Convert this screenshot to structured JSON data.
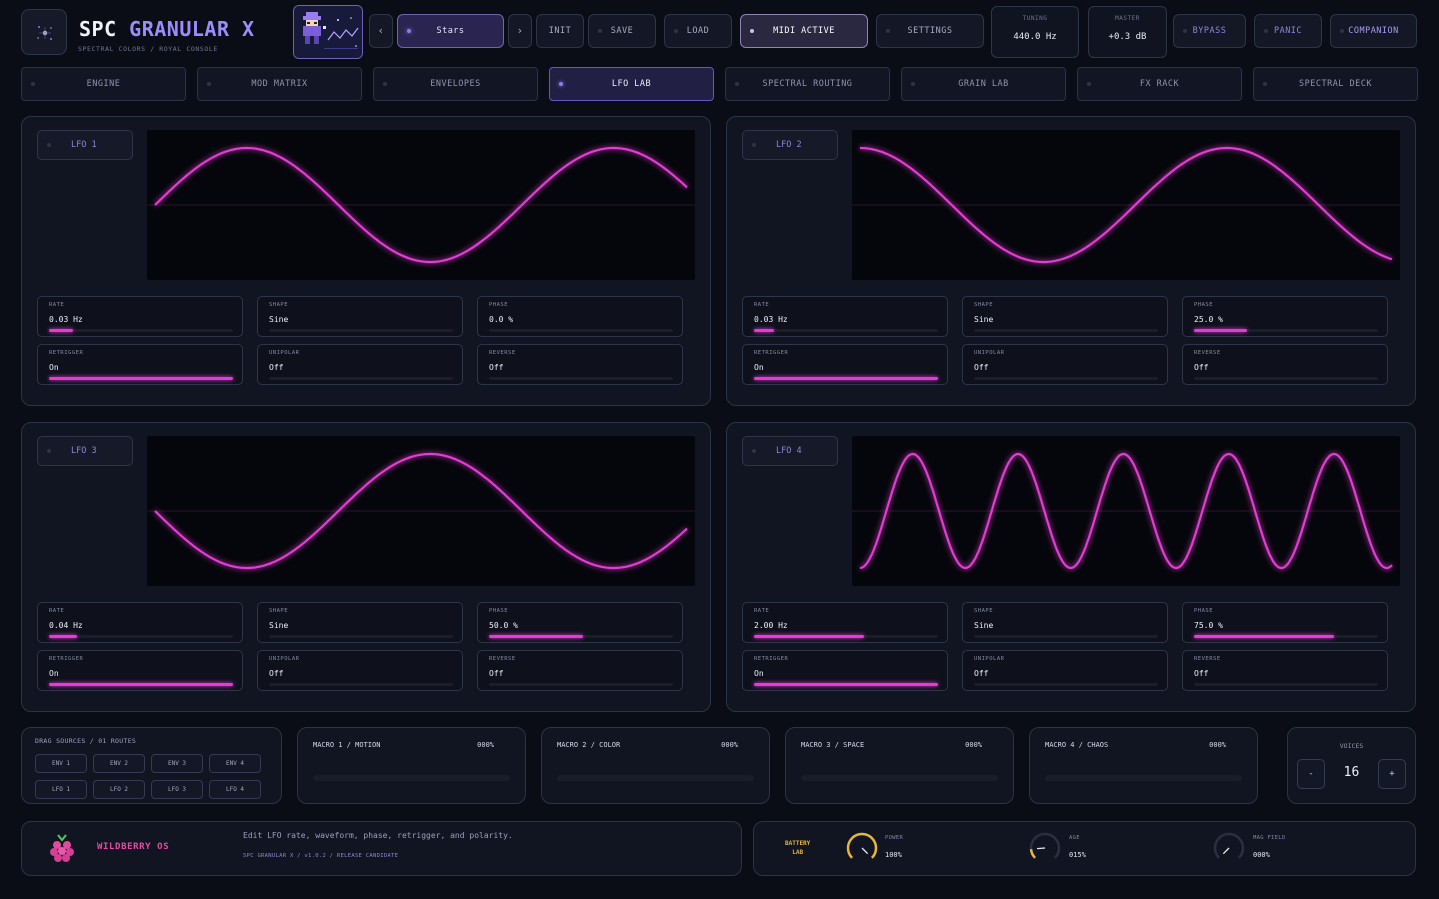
{
  "header": {
    "title_a": "SPC",
    "title_b": "GRANULAR",
    "title_c": "X",
    "subtitle": "SPECTRAL COLORS / ROYAL CONSOLE",
    "preset_prev_icon": "chevron-left-icon",
    "preset_next_icon": "chevron-right-icon",
    "preset_name": "Stars",
    "buttons": {
      "init": "INIT",
      "save": "SAVE",
      "load": "LOAD",
      "midi": "MIDI ACTIVE",
      "settings": "SETTINGS",
      "bypass": "BYPASS",
      "panic": "PANIC",
      "companion": "COMPANION"
    },
    "tuning": {
      "label": "TUNING",
      "value": "440.0 Hz"
    },
    "master": {
      "label": "MASTER",
      "value": "+0.3 dB"
    }
  },
  "tabs": [
    {
      "label": "ENGINE",
      "active": false
    },
    {
      "label": "MOD MATRIX",
      "active": false
    },
    {
      "label": "ENVELOPES",
      "active": false
    },
    {
      "label": "LFO LAB",
      "active": true
    },
    {
      "label": "SPECTRAL ROUTING",
      "active": false
    },
    {
      "label": "GRAIN LAB",
      "active": false
    },
    {
      "label": "FX RACK",
      "active": false
    },
    {
      "label": "SPECTRAL DECK",
      "active": false
    }
  ],
  "param_labels": {
    "rate": "RATE",
    "shape": "SHAPE",
    "phase": "PHASE",
    "retrigger": "RETRIGGER",
    "unipolar": "UNIPOLAR",
    "reverse": "REVERSE"
  },
  "lfos": [
    {
      "name": "LFO 1",
      "rate": "0.03 Hz",
      "rate_level": 0.13,
      "shape": "Sine",
      "phase": "0.0 %",
      "phase_level": 0.0,
      "retrigger": "On",
      "retrigger_level": 1.0,
      "unipolar": "Off",
      "reverse": "Off",
      "cycles": 1.45,
      "phase_deg": 0
    },
    {
      "name": "LFO 2",
      "rate": "0.03 Hz",
      "rate_level": 0.11,
      "shape": "Sine",
      "phase": "25.0 %",
      "phase_level": 0.29,
      "retrigger": "On",
      "retrigger_level": 1.0,
      "unipolar": "Off",
      "reverse": "Off",
      "cycles": 1.45,
      "phase_deg": 90
    },
    {
      "name": "LFO 3",
      "rate": "0.04 Hz",
      "rate_level": 0.15,
      "shape": "Sine",
      "phase": "50.0 %",
      "phase_level": 0.51,
      "retrigger": "On",
      "retrigger_level": 1.0,
      "unipolar": "Off",
      "reverse": "Off",
      "cycles": 1.45,
      "phase_deg": 180
    },
    {
      "name": "LFO 4",
      "rate": "2.00 Hz",
      "rate_level": 0.6,
      "shape": "Sine",
      "phase": "75.0 %",
      "phase_level": 0.76,
      "retrigger": "On",
      "retrigger_level": 1.0,
      "unipolar": "Off",
      "reverse": "Off",
      "cycles": 5.05,
      "phase_deg": 270
    }
  ],
  "drag": {
    "title": "DRAG SOURCES / 01 ROUTES",
    "chips": [
      "ENV 1",
      "ENV 2",
      "ENV 3",
      "ENV 4",
      "LFO 1",
      "LFO 2",
      "LFO 3",
      "LFO 4"
    ]
  },
  "macros": [
    {
      "name": "MACRO 1 / MOTION",
      "value": "000%"
    },
    {
      "name": "MACRO 2 / COLOR",
      "value": "000%"
    },
    {
      "name": "MACRO 3 / SPACE",
      "value": "000%"
    },
    {
      "name": "MACRO 4 / CHAOS",
      "value": "000%"
    }
  ],
  "voices": {
    "label": "VOICES",
    "value": "16",
    "minus": "-",
    "plus": "+"
  },
  "footer": {
    "os_name": "WILDBERRY OS",
    "hint": "Edit LFO rate, waveform, phase, retrigger, and polarity.",
    "version": "SPC GRANULAR X / v1.0.2 / RELEASE CANDIDATE",
    "battery_line1": "BATTERY",
    "battery_line2": "LAB",
    "power": {
      "label": "POWER",
      "value": "100%",
      "level": 1.0
    },
    "age": {
      "label": "AGE",
      "value": "015%",
      "level": 0.15
    },
    "mag": {
      "label": "MAG FIELD",
      "value": "000%",
      "level": 0.0
    }
  },
  "colors": {
    "accent": "#8b7cf0",
    "wave": "#e33bd4",
    "title": "#9d8cff",
    "os": "#e34aa6",
    "battery": "#e6b63a"
  }
}
